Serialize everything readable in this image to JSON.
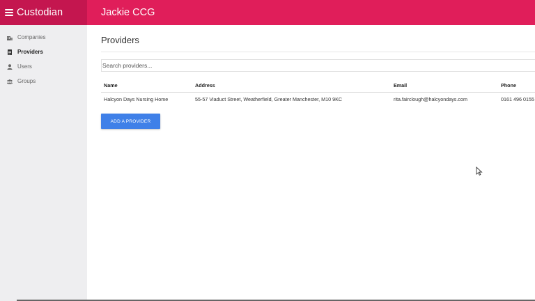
{
  "app": {
    "title": "Custodian"
  },
  "header": {
    "title": "Jackie CCG"
  },
  "sidebar": {
    "items": [
      {
        "label": "Companies",
        "icon": "building-icon",
        "active": false
      },
      {
        "label": "Providers",
        "icon": "clipboard-icon",
        "active": true
      },
      {
        "label": "Users",
        "icon": "user-icon",
        "active": false
      },
      {
        "label": "Groups",
        "icon": "users-icon",
        "active": false
      }
    ]
  },
  "main": {
    "title": "Providers",
    "search": {
      "placeholder": "Search providers...",
      "value": ""
    },
    "table": {
      "headers": [
        "Name",
        "Address",
        "Email",
        "Phone"
      ],
      "rows": [
        [
          "Halcyon Days Nursing Home",
          "55-57 Viaduct Street, Weatherfield, Greater Manchester, M10 9KC",
          "rita.fairclough@halcyondays.com",
          "0161 496 0155"
        ]
      ]
    },
    "add_button": "ADD A PROVIDER"
  },
  "colors": {
    "brand": "#c4164f",
    "header": "#e01e5a",
    "primary_button": "#3f80e8",
    "sidebar_bg": "#eeeef0"
  }
}
